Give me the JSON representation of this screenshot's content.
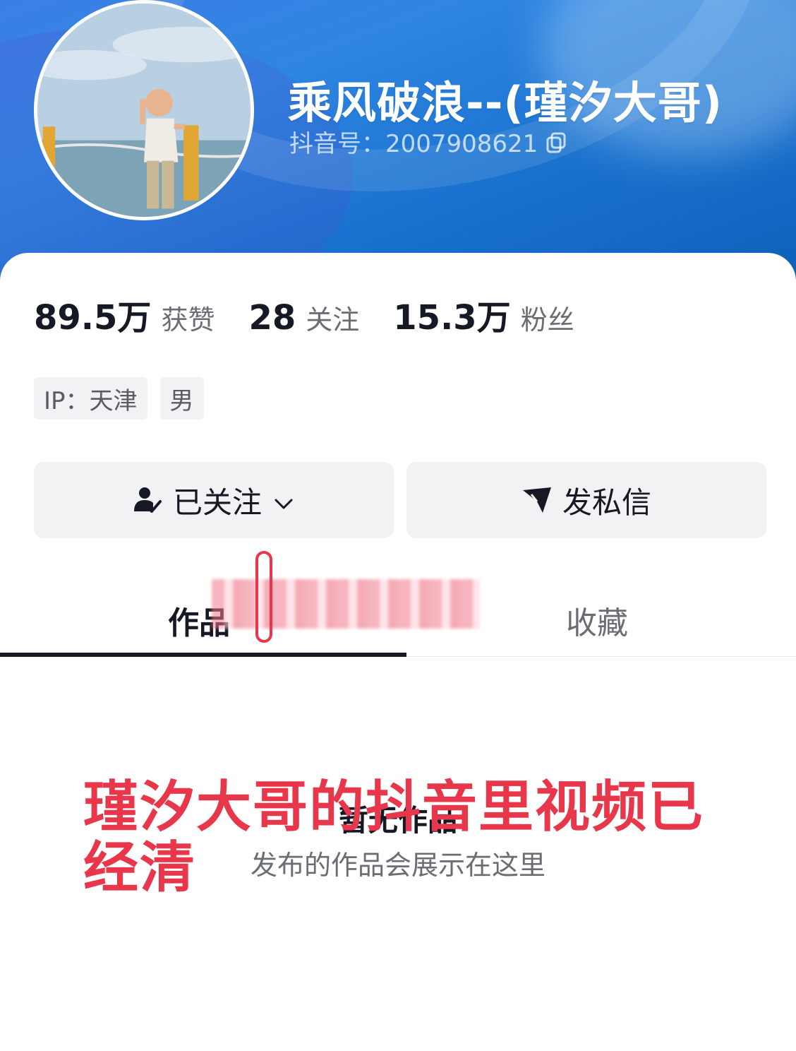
{
  "profile": {
    "nickname": "乘风破浪--(瑾汐大哥)",
    "douyin_id": "抖音号：2007908621",
    "stats": [
      {
        "value": "89.5万",
        "label": "获赞"
      },
      {
        "value": "28",
        "label": "关注"
      },
      {
        "value": "15.3万",
        "label": "粉丝"
      }
    ],
    "tags": [
      "IP：天津",
      "男"
    ]
  },
  "actions": {
    "follow_label": "已关注",
    "message_label": "发私信"
  },
  "tabs": [
    {
      "label": "作品",
      "active": true
    },
    {
      "label": "收藏",
      "active": false
    }
  ],
  "empty_state": {
    "title": "暂无作品",
    "subtitle": "发布的作品会展示在这里"
  },
  "overlay_caption": {
    "line1": "瑾汐大哥的抖音里视频已",
    "line2": "经清"
  },
  "colors": {
    "header_blue": "#1b73d0",
    "overlay_red": "#e8374a",
    "text_primary": "#161823",
    "text_secondary": "#6b6d75",
    "button_bg": "#f2f2f4"
  },
  "icons": {
    "copy": "copy-icon",
    "follow": "user-check-icon",
    "chevron": "chevron-down-icon",
    "message": "send-icon"
  }
}
